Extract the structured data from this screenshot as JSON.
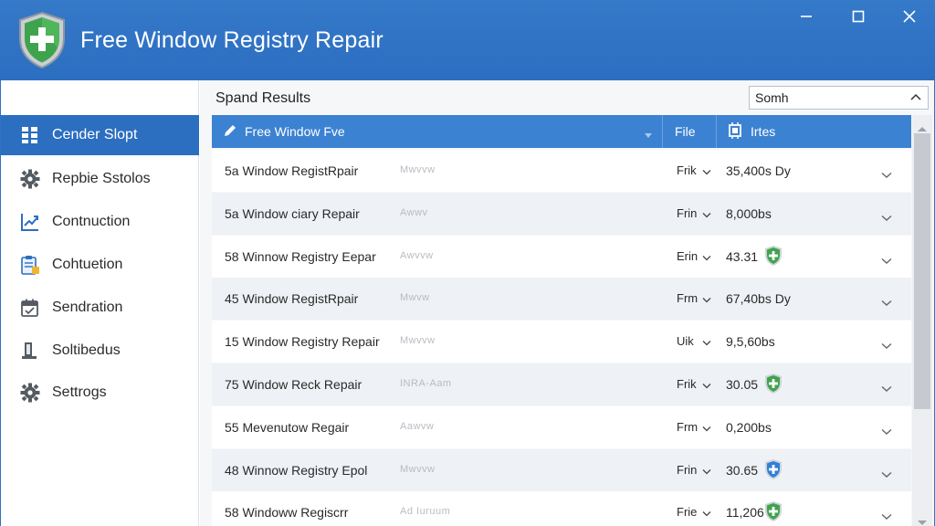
{
  "app": {
    "title": "Free Window Registry Repair"
  },
  "sidebar": {
    "items": [
      {
        "label": "Cender Slopt",
        "icon": "grid-icon"
      },
      {
        "label": "Repbie Sstolos",
        "icon": "gear-icon"
      },
      {
        "label": "Contnuction",
        "icon": "chart-icon"
      },
      {
        "label": "Cohtuetion",
        "icon": "clipboard-icon"
      },
      {
        "label": "Sendration",
        "icon": "calendar-icon"
      },
      {
        "label": "Soltibedus",
        "icon": "document-icon"
      },
      {
        "label": "Settrogs",
        "icon": "gear-icon"
      }
    ]
  },
  "main": {
    "title": "Spand Results",
    "search": {
      "value": "Somh"
    },
    "columns": {
      "name": "Free Window Fve",
      "file": "File",
      "bytes": "Irtes"
    },
    "rows": [
      {
        "name": "5a Window RegistRpair",
        "note": "Mwvvw",
        "file": "Frik",
        "size": "35,400s Dy",
        "shield": ""
      },
      {
        "name": "5a Window ciary Repair",
        "note": "Awwv",
        "file": "Frin",
        "size": "8,000bs",
        "shield": ""
      },
      {
        "name": "58 Winnow Registry Eepar",
        "note": "Awvvw",
        "file": "Erin",
        "size": "43.31",
        "shield": "green"
      },
      {
        "name": "45 Window RegistRpair",
        "note": "Mwvw",
        "file": "Frm",
        "size": "67,40bs Dy",
        "shield": ""
      },
      {
        "name": "15 Window Registry Repair",
        "note": "Mwvvw",
        "file": "Uik",
        "size": "9,5,60bs",
        "shield": ""
      },
      {
        "name": "75 Window Reck Repair",
        "note": "INRA-Aam",
        "file": "Frik",
        "size": "30.05",
        "shield": "green"
      },
      {
        "name": "55 Mevenutow Regair",
        "note": "Aawvw",
        "file": "Frm",
        "size": "0,200bs",
        "shield": ""
      },
      {
        "name": "48 Winnow Registry Epol",
        "note": "Mwvvw",
        "file": "Frin",
        "size": "30.65",
        "shield": "blue"
      },
      {
        "name": "58 Windoww Regiscrr",
        "note": "Ad Iuruum",
        "file": "Frie",
        "size": "11,206",
        "shield": "green"
      }
    ]
  },
  "colors": {
    "titlebar": "#2c6ec0",
    "accent": "#3c82d2",
    "shield_green": "#3fa34d",
    "shield_blue": "#2f7fd6"
  }
}
